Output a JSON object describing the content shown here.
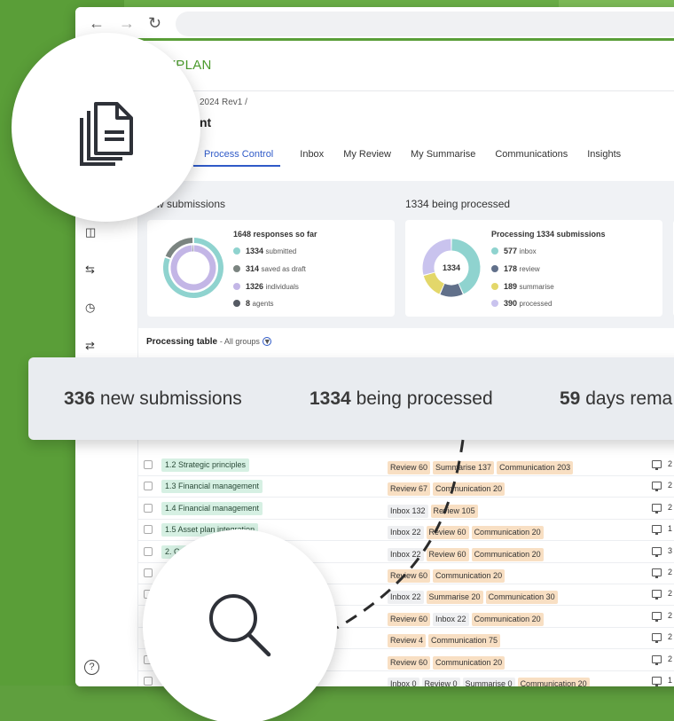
{
  "app": {
    "logo": "YPLAN",
    "breadcrumb": "2024 Rev1 /",
    "page_title": "nt"
  },
  "tabs": [
    {
      "label": "Process Control",
      "active": true
    },
    {
      "label": "Inbox"
    },
    {
      "label": "My Review"
    },
    {
      "label": "My Summarise"
    },
    {
      "label": "Communications"
    },
    {
      "label": "Insights"
    }
  ],
  "stats": {
    "new_title": "w submissions",
    "processing_title": "1334 being processed",
    "third_title_fragment": "5"
  },
  "card_submissions": {
    "heading": "1648 responses so far",
    "legend": [
      {
        "value": "1334",
        "label": "submitted",
        "color": "#8fd3cf"
      },
      {
        "value": "314",
        "label": "saved as draft",
        "color": "#7b8480"
      },
      {
        "value": "1326",
        "label": "individuals",
        "color": "#c3b6e6"
      },
      {
        "value": "8",
        "label": "agents",
        "color": "#555a63"
      }
    ]
  },
  "card_processing": {
    "heading": "Processing 1334 submissions",
    "donut_label": "1334",
    "legend": [
      {
        "value": "577",
        "label": "inbox",
        "color": "#8fd3cf"
      },
      {
        "value": "178",
        "label": "review",
        "color": "#61708a"
      },
      {
        "value": "189",
        "label": "summarise",
        "color": "#e3d76a"
      },
      {
        "value": "390",
        "label": "processed",
        "color": "#c9c3ee"
      }
    ]
  },
  "table": {
    "title": "Processing table",
    "subtitle": "- All groups",
    "rows": [
      {
        "item": "1.2 Strategic principles",
        "statuses": [
          [
            "Review 60",
            "orange"
          ],
          [
            "Summarise 137",
            "orange"
          ],
          [
            "Communication 203",
            "orange"
          ]
        ],
        "count": "2"
      },
      {
        "item": "1.3 Financial management",
        "statuses": [
          [
            "Review 67",
            "orange"
          ],
          [
            "Communication 20",
            "orange"
          ]
        ],
        "count": "2"
      },
      {
        "item": "1.4 Financial management",
        "statuses": [
          [
            "Inbox 132",
            "grey"
          ],
          [
            "Review 105",
            "orange"
          ]
        ],
        "count": "2"
      },
      {
        "item": "1.5 Asset plan integration",
        "statuses": [
          [
            "Inbox 22",
            "grey"
          ],
          [
            "Review 60",
            "orange"
          ],
          [
            "Communication 20",
            "orange"
          ]
        ],
        "count": "1"
      },
      {
        "item": "2. Comm",
        "statuses": [
          [
            "Inbox 22",
            "grey"
          ],
          [
            "Review 60",
            "orange"
          ],
          [
            "Communication 20",
            "orange"
          ]
        ],
        "count": "3"
      },
      {
        "item": "",
        "statuses": [
          [
            "Review 60",
            "orange"
          ],
          [
            "Communication 20",
            "orange"
          ]
        ],
        "count": "2"
      },
      {
        "item": "",
        "statuses": [
          [
            "Inbox 22",
            "grey"
          ],
          [
            "Summarise 20",
            "orange"
          ],
          [
            "Communication 30",
            "orange"
          ]
        ],
        "count": "2"
      },
      {
        "item": "",
        "statuses": [
          [
            "Review 60",
            "orange"
          ],
          [
            "Inbox 22",
            "grey"
          ],
          [
            "Communication 20",
            "orange"
          ]
        ],
        "count": "2"
      },
      {
        "item": "",
        "statuses": [
          [
            "Review 4",
            "orange"
          ],
          [
            "Communication 75",
            "orange"
          ]
        ],
        "count": "2"
      },
      {
        "item": "",
        "statuses": [
          [
            "Review 60",
            "orange"
          ],
          [
            "Communication 20",
            "orange"
          ]
        ],
        "count": "2"
      },
      {
        "item": "",
        "statuses": [
          [
            "Inbox 0",
            "grey"
          ],
          [
            "Review 0",
            "grey"
          ],
          [
            "Summarise 0",
            "grey"
          ],
          [
            "Communication 20",
            "orange"
          ]
        ],
        "count": "1"
      }
    ]
  },
  "banner": {
    "new_value": "336",
    "new_label": "new submissions",
    "processing_value": "1334",
    "processing_label": "being processed",
    "days_value": "59",
    "days_label": "days rema"
  },
  "donut_submissions": [
    {
      "label": "submitted",
      "value": 1334,
      "color": "#8fd3cf"
    },
    {
      "label": "saved as draft",
      "value": 314,
      "color": "#7b8480"
    }
  ],
  "donut_individuals": [
    {
      "label": "individuals",
      "value": 1326,
      "color": "#c3b6e6"
    },
    {
      "label": "agents",
      "value": 8,
      "color": "#555a63"
    }
  ]
}
